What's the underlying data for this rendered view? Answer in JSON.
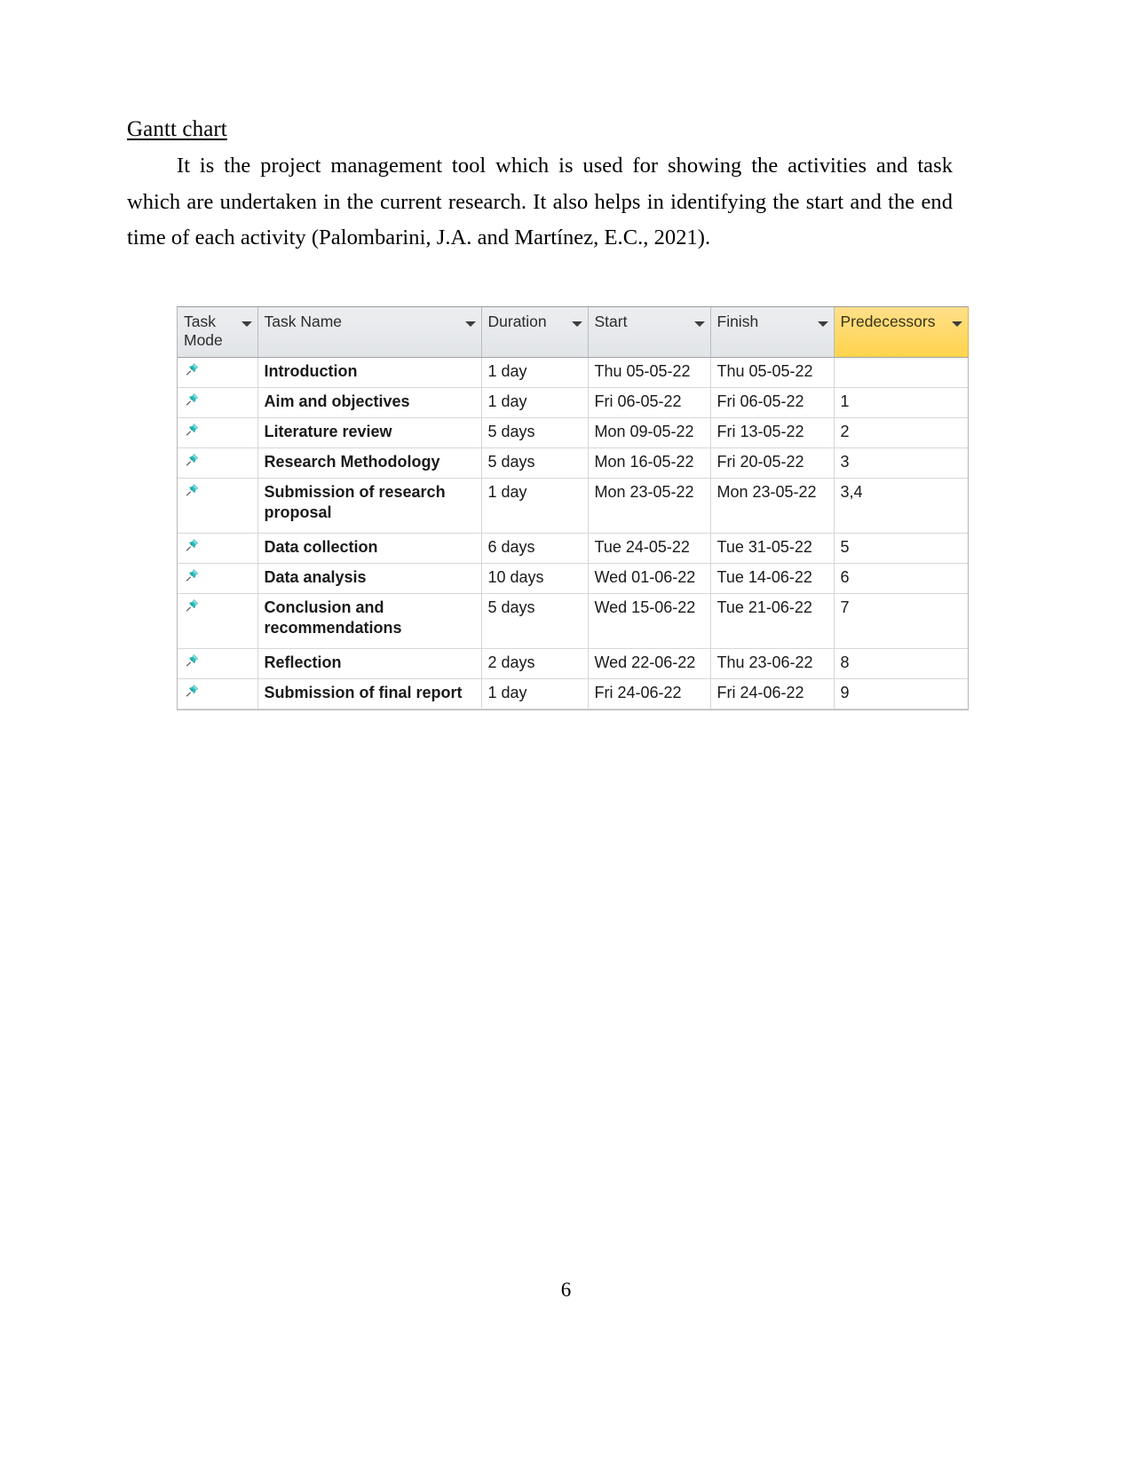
{
  "document": {
    "heading": "Gantt chart ",
    "paragraph": "It is the project management tool which is used for showing the activities and task which are undertaken in the current research. It also helps in identifying the start and the end time of each activity (Palombarini, J.A. and Martínez, E.C., 2021).",
    "page_number": "6"
  },
  "colors": {
    "header_background": "#e6e8ea",
    "predecessors_header_background": "#ffd966",
    "pin_icon": "#2ec4c4",
    "selected_cell": "#e4ecf7",
    "grid_line": "#d5d7da"
  },
  "grid": {
    "columns": [
      {
        "key": "task_mode",
        "label": "Task Mode",
        "has_filter": true,
        "highlighted": false
      },
      {
        "key": "task_name",
        "label": "Task Name",
        "has_filter": true,
        "highlighted": false
      },
      {
        "key": "duration",
        "label": "Duration",
        "has_filter": true,
        "highlighted": false
      },
      {
        "key": "start",
        "label": "Start",
        "has_filter": true,
        "highlighted": false
      },
      {
        "key": "finish",
        "label": "Finish",
        "has_filter": true,
        "highlighted": false
      },
      {
        "key": "predecessors",
        "label": "Predecessors",
        "has_filter": true,
        "highlighted": true
      }
    ],
    "rows": [
      {
        "mode_icon": "pushpin-icon",
        "task_name": "Introduction",
        "duration": "1 day",
        "start": "Thu 05-05-22",
        "finish": "Thu 05-05-22",
        "predecessors": "",
        "selected": false,
        "tall": false
      },
      {
        "mode_icon": "pushpin-icon",
        "task_name": "Aim and objectives",
        "duration": "1 day",
        "start": "Fri 06-05-22",
        "finish": "Fri 06-05-22",
        "predecessors": "1",
        "selected": false,
        "tall": false
      },
      {
        "mode_icon": "pushpin-icon",
        "task_name": "Literature review",
        "duration": "5 days",
        "start": "Mon 09-05-22",
        "finish": "Fri 13-05-22",
        "predecessors": "2",
        "selected": false,
        "tall": false
      },
      {
        "mode_icon": "pushpin-icon",
        "task_name": "Research Methodology",
        "duration": "5 days",
        "start": "Mon 16-05-22",
        "finish": "Fri 20-05-22",
        "predecessors": "3",
        "selected": false,
        "tall": false
      },
      {
        "mode_icon": "pushpin-icon",
        "task_name": "Submission of research proposal",
        "duration": "1 day",
        "start": "Mon 23-05-22",
        "finish": "Mon 23-05-22",
        "predecessors": "3,4",
        "selected": false,
        "tall": true
      },
      {
        "mode_icon": "pushpin-icon",
        "task_name": "Data collection",
        "duration": "6 days",
        "start": "Tue 24-05-22",
        "finish": "Tue 31-05-22",
        "predecessors": "5",
        "selected": false,
        "tall": false
      },
      {
        "mode_icon": "pushpin-icon",
        "task_name": "Data analysis",
        "duration": "10 days",
        "start": "Wed 01-06-22",
        "finish": "Tue 14-06-22",
        "predecessors": "6",
        "selected": false,
        "tall": false
      },
      {
        "mode_icon": "pushpin-icon",
        "task_name": "Conclusion and recommendations",
        "duration": "5 days",
        "start": "Wed 15-06-22",
        "finish": "Tue 21-06-22",
        "predecessors": "7",
        "selected": false,
        "tall": true
      },
      {
        "mode_icon": "pushpin-icon",
        "task_name": "Reflection",
        "duration": "2 days",
        "start": "Wed 22-06-22",
        "finish": "Thu 23-06-22",
        "predecessors": "8",
        "selected": false,
        "tall": false
      },
      {
        "mode_icon": "pushpin-icon",
        "task_name": "Submission of final report",
        "duration": "1 day",
        "start": "Fri 24-06-22",
        "finish": "Fri 24-06-22",
        "predecessors": "9",
        "selected": true,
        "tall": false
      }
    ]
  }
}
